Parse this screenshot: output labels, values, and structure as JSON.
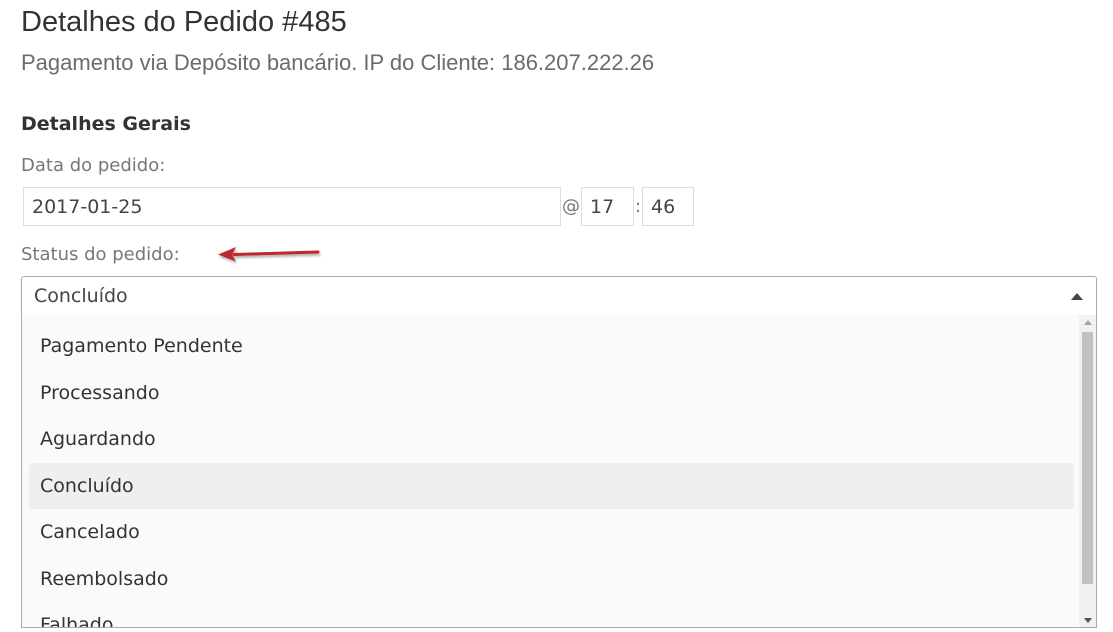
{
  "order": {
    "title": "Detalhes do Pedido #485",
    "subtitle": "Pagamento via Depósito bancário. IP do Cliente: 186.207.222.26"
  },
  "general": {
    "heading": "Detalhes Gerais",
    "date_label": "Data do pedido:",
    "date_value": "2017-01-25",
    "at_separator": "@",
    "hour_value": "17",
    "time_separator": ":",
    "minute_value": "46",
    "status_label": "Status do pedido:",
    "status_selected": "Concluído",
    "status_options": [
      "Pagamento Pendente",
      "Processando",
      "Aguardando",
      "Concluído",
      "Cancelado",
      "Reembolsado",
      "Falhado"
    ]
  },
  "colors": {
    "annotation_arrow": "#c0282d",
    "selected_option_bg": "#efefef"
  },
  "icons": {
    "select_caret": "caret-up-icon",
    "annotation": "arrow-left-icon"
  }
}
